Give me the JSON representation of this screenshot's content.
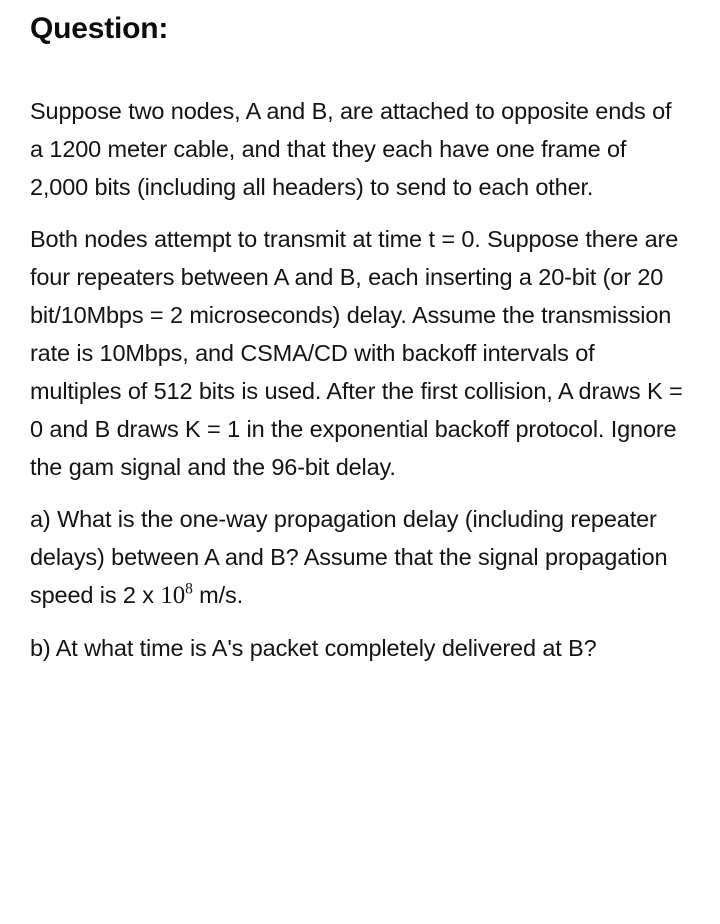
{
  "document": {
    "title": "Question:",
    "background_color": "#ffffff",
    "text_color": "#141414",
    "paragraphs": [
      {
        "id": "setup",
        "text": "Suppose two nodes, A and B, are attached to opposite ends of a 1200 meter cable, and that they each have one frame of 2,000 bits (including all headers) to send to each other."
      },
      {
        "id": "assumptions",
        "text": "Both nodes attempt to transmit at time t = 0. Suppose there are four repeaters between A and B, each inserting a 20-bit (or 20 bit/10Mbps = 2 microseconds) delay. Assume the transmission rate is 10Mbps, and CSMA/CD with backoff intervals of multiples of 512 bits is used. After the first collision, A draws K = 0 and B draws K = 1 in the exponential backoff protocol. Ignore the gam signal and the 96-bit delay."
      }
    ],
    "questions": [
      {
        "id": "part-a",
        "label": "a)",
        "text_before_math": "a) What is the one-way propagation delay (including repeater delays) between A and B? Assume that the signal propagation speed is 2 x ",
        "math_base": "10",
        "math_exponent": "8",
        "text_after_math": " m/s."
      },
      {
        "id": "part-b",
        "label": "b)",
        "text": "b) At what time is A's packet completely delivered at B?"
      }
    ]
  }
}
